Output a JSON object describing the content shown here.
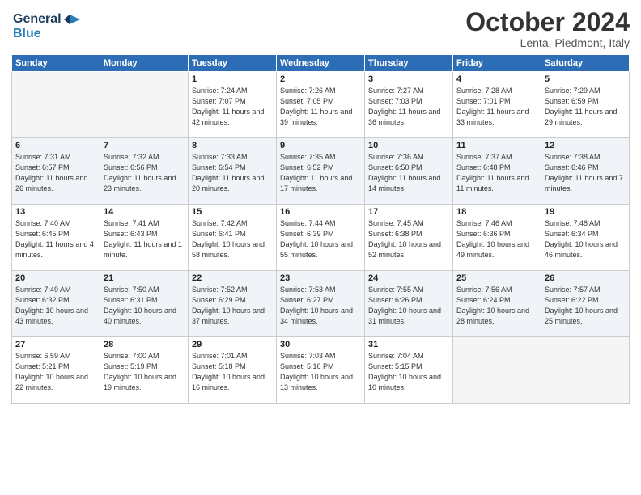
{
  "header": {
    "logo_line1": "General",
    "logo_line2": "Blue",
    "title": "October 2024",
    "location": "Lenta, Piedmont, Italy"
  },
  "weekdays": [
    "Sunday",
    "Monday",
    "Tuesday",
    "Wednesday",
    "Thursday",
    "Friday",
    "Saturday"
  ],
  "weeks": [
    [
      {
        "day": "",
        "info": ""
      },
      {
        "day": "",
        "info": ""
      },
      {
        "day": "1",
        "info": "Sunrise: 7:24 AM\nSunset: 7:07 PM\nDaylight: 11 hours and 42 minutes."
      },
      {
        "day": "2",
        "info": "Sunrise: 7:26 AM\nSunset: 7:05 PM\nDaylight: 11 hours and 39 minutes."
      },
      {
        "day": "3",
        "info": "Sunrise: 7:27 AM\nSunset: 7:03 PM\nDaylight: 11 hours and 36 minutes."
      },
      {
        "day": "4",
        "info": "Sunrise: 7:28 AM\nSunset: 7:01 PM\nDaylight: 11 hours and 33 minutes."
      },
      {
        "day": "5",
        "info": "Sunrise: 7:29 AM\nSunset: 6:59 PM\nDaylight: 11 hours and 29 minutes."
      }
    ],
    [
      {
        "day": "6",
        "info": "Sunrise: 7:31 AM\nSunset: 6:57 PM\nDaylight: 11 hours and 26 minutes."
      },
      {
        "day": "7",
        "info": "Sunrise: 7:32 AM\nSunset: 6:56 PM\nDaylight: 11 hours and 23 minutes."
      },
      {
        "day": "8",
        "info": "Sunrise: 7:33 AM\nSunset: 6:54 PM\nDaylight: 11 hours and 20 minutes."
      },
      {
        "day": "9",
        "info": "Sunrise: 7:35 AM\nSunset: 6:52 PM\nDaylight: 11 hours and 17 minutes."
      },
      {
        "day": "10",
        "info": "Sunrise: 7:36 AM\nSunset: 6:50 PM\nDaylight: 11 hours and 14 minutes."
      },
      {
        "day": "11",
        "info": "Sunrise: 7:37 AM\nSunset: 6:48 PM\nDaylight: 11 hours and 11 minutes."
      },
      {
        "day": "12",
        "info": "Sunrise: 7:38 AM\nSunset: 6:46 PM\nDaylight: 11 hours and 7 minutes."
      }
    ],
    [
      {
        "day": "13",
        "info": "Sunrise: 7:40 AM\nSunset: 6:45 PM\nDaylight: 11 hours and 4 minutes."
      },
      {
        "day": "14",
        "info": "Sunrise: 7:41 AM\nSunset: 6:43 PM\nDaylight: 11 hours and 1 minute."
      },
      {
        "day": "15",
        "info": "Sunrise: 7:42 AM\nSunset: 6:41 PM\nDaylight: 10 hours and 58 minutes."
      },
      {
        "day": "16",
        "info": "Sunrise: 7:44 AM\nSunset: 6:39 PM\nDaylight: 10 hours and 55 minutes."
      },
      {
        "day": "17",
        "info": "Sunrise: 7:45 AM\nSunset: 6:38 PM\nDaylight: 10 hours and 52 minutes."
      },
      {
        "day": "18",
        "info": "Sunrise: 7:46 AM\nSunset: 6:36 PM\nDaylight: 10 hours and 49 minutes."
      },
      {
        "day": "19",
        "info": "Sunrise: 7:48 AM\nSunset: 6:34 PM\nDaylight: 10 hours and 46 minutes."
      }
    ],
    [
      {
        "day": "20",
        "info": "Sunrise: 7:49 AM\nSunset: 6:32 PM\nDaylight: 10 hours and 43 minutes."
      },
      {
        "day": "21",
        "info": "Sunrise: 7:50 AM\nSunset: 6:31 PM\nDaylight: 10 hours and 40 minutes."
      },
      {
        "day": "22",
        "info": "Sunrise: 7:52 AM\nSunset: 6:29 PM\nDaylight: 10 hours and 37 minutes."
      },
      {
        "day": "23",
        "info": "Sunrise: 7:53 AM\nSunset: 6:27 PM\nDaylight: 10 hours and 34 minutes."
      },
      {
        "day": "24",
        "info": "Sunrise: 7:55 AM\nSunset: 6:26 PM\nDaylight: 10 hours and 31 minutes."
      },
      {
        "day": "25",
        "info": "Sunrise: 7:56 AM\nSunset: 6:24 PM\nDaylight: 10 hours and 28 minutes."
      },
      {
        "day": "26",
        "info": "Sunrise: 7:57 AM\nSunset: 6:22 PM\nDaylight: 10 hours and 25 minutes."
      }
    ],
    [
      {
        "day": "27",
        "info": "Sunrise: 6:59 AM\nSunset: 5:21 PM\nDaylight: 10 hours and 22 minutes."
      },
      {
        "day": "28",
        "info": "Sunrise: 7:00 AM\nSunset: 5:19 PM\nDaylight: 10 hours and 19 minutes."
      },
      {
        "day": "29",
        "info": "Sunrise: 7:01 AM\nSunset: 5:18 PM\nDaylight: 10 hours and 16 minutes."
      },
      {
        "day": "30",
        "info": "Sunrise: 7:03 AM\nSunset: 5:16 PM\nDaylight: 10 hours and 13 minutes."
      },
      {
        "day": "31",
        "info": "Sunrise: 7:04 AM\nSunset: 5:15 PM\nDaylight: 10 hours and 10 minutes."
      },
      {
        "day": "",
        "info": ""
      },
      {
        "day": "",
        "info": ""
      }
    ]
  ]
}
